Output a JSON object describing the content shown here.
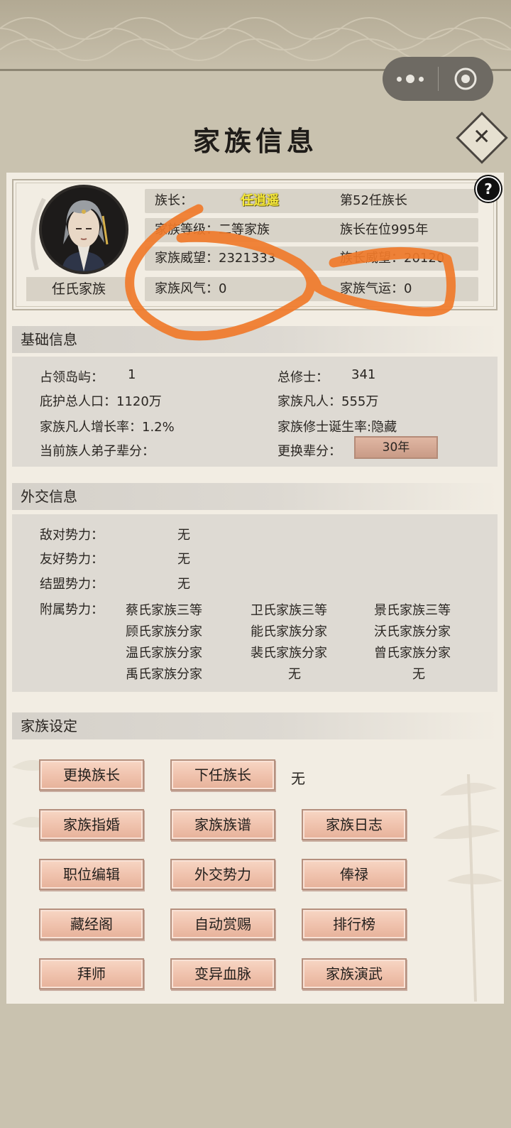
{
  "header": {
    "title": "家族信息"
  },
  "profile": {
    "family_name": "任氏家族",
    "leader_label": "族长：",
    "leader_name": "任逍遥",
    "leader_order": "第52任族长",
    "family_level": "家族等级：二等家族",
    "leader_tenure": "族长在位995年",
    "prestige": "家族威望：2321333",
    "leader_achievement": "族长威望：20120",
    "atmosphere": "家族风气：0",
    "fortune": "家族气运：0"
  },
  "basic": {
    "header": "基础信息",
    "islands_label": "占领岛屿：",
    "islands_value": "1",
    "cultivators_label": "总修士：",
    "cultivators_value": "341",
    "population": "庇护总人口：1120万",
    "mortals": "家族凡人：555万",
    "growth_rate": "家族凡人增长率：1.2%",
    "cultivator_birth": "家族修士诞生率:隐藏",
    "generation_label": "当前族人弟子辈分：",
    "change_generation_label": "更换辈分：",
    "change_generation_value": "30年"
  },
  "diplomacy": {
    "header": "外交信息",
    "hostile_label": "敌对势力：",
    "hostile_value": "无",
    "friendly_label": "友好势力：",
    "friendly_value": "无",
    "allied_label": "结盟势力：",
    "allied_value": "无",
    "vassal_label": "附属势力：",
    "vassals": [
      "蔡氏家族三等",
      "卫氏家族三等",
      "景氏家族三等",
      "顾氏家族分家",
      "能氏家族分家",
      "沃氏家族分家",
      "温氏家族分家",
      "裴氏家族分家",
      "曾氏家族分家",
      "禹氏家族分家",
      "无",
      "无"
    ]
  },
  "settings": {
    "header": "家族设定",
    "next_leader_value": "无",
    "buttons": [
      "更换族长",
      "下任族长",
      "家族指婚",
      "家族族谱",
      "家族日志",
      "职位编辑",
      "外交势力",
      "俸禄",
      "藏经阁",
      "自动赏赐",
      "排行榜",
      "拜师",
      "变异血脉",
      "家族演武"
    ]
  },
  "colors": {
    "background": "#c9c2af",
    "panel": "#f2ede3",
    "button": "#f0c3ae",
    "leader_name": "#f5e83a",
    "annotation": "#f07a2a"
  }
}
